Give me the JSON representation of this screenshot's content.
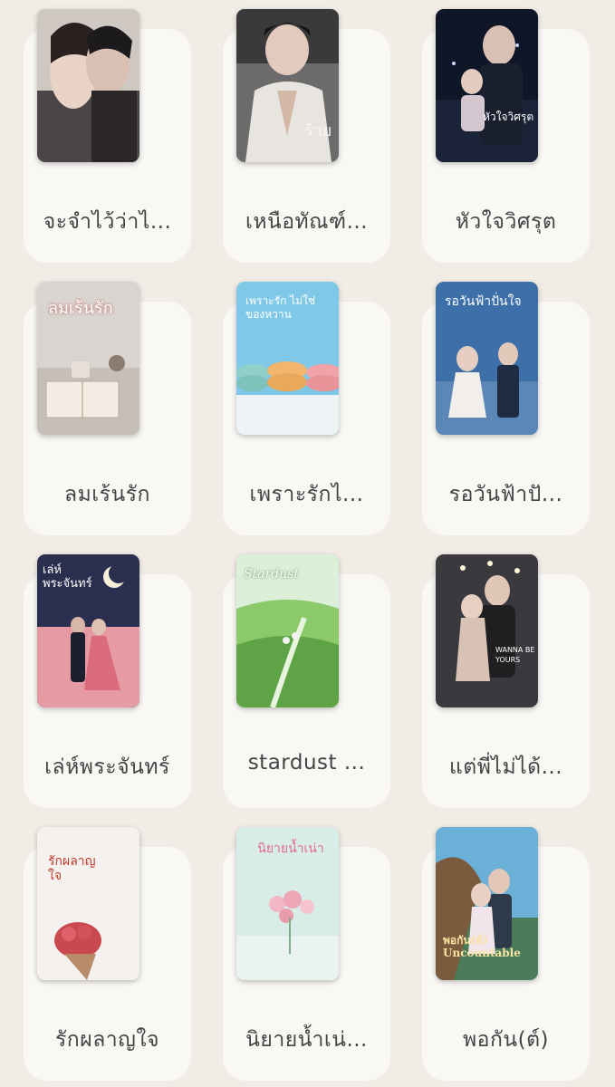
{
  "books": [
    {
      "title": "จะจำไว้ว่าไ...",
      "cover_text": ""
    },
    {
      "title": "เหนือทัณฑ์...",
      "cover_text": ""
    },
    {
      "title": "หัวใจวิศรุต",
      "cover_text": "หัวใจวิศรุต"
    },
    {
      "title": "ลมเร้นรัก",
      "cover_text": "ลมเร้นรัก"
    },
    {
      "title": "เพราะรักไ...",
      "cover_text": "เพราะรัก ไม่ใช่ ของหวาน"
    },
    {
      "title": "รอวันฟ้าปั...",
      "cover_text": "รอวันฟ้าปั่นใจ"
    },
    {
      "title": "เล่ห์พระจันทร์",
      "cover_text": "เล่ห์พระจันทร์"
    },
    {
      "title": "stardust ...",
      "cover_text": "Stardust"
    },
    {
      "title": "แต่พี่ไม่ได้...",
      "cover_text": "WANNA BE YOURS"
    },
    {
      "title": "รักผลาญใจ",
      "cover_text": "รักผลาญใจ"
    },
    {
      "title": "นิยายน้ำเน่...",
      "cover_text": "นิยายน้ำเน่า"
    },
    {
      "title": "พอกัน(ต์)",
      "cover_text": "พอกัน(ต์) Uncountable"
    }
  ],
  "colors": {
    "background": "#f2ece6",
    "card": "#faf8f5",
    "title_text": "#444444"
  }
}
